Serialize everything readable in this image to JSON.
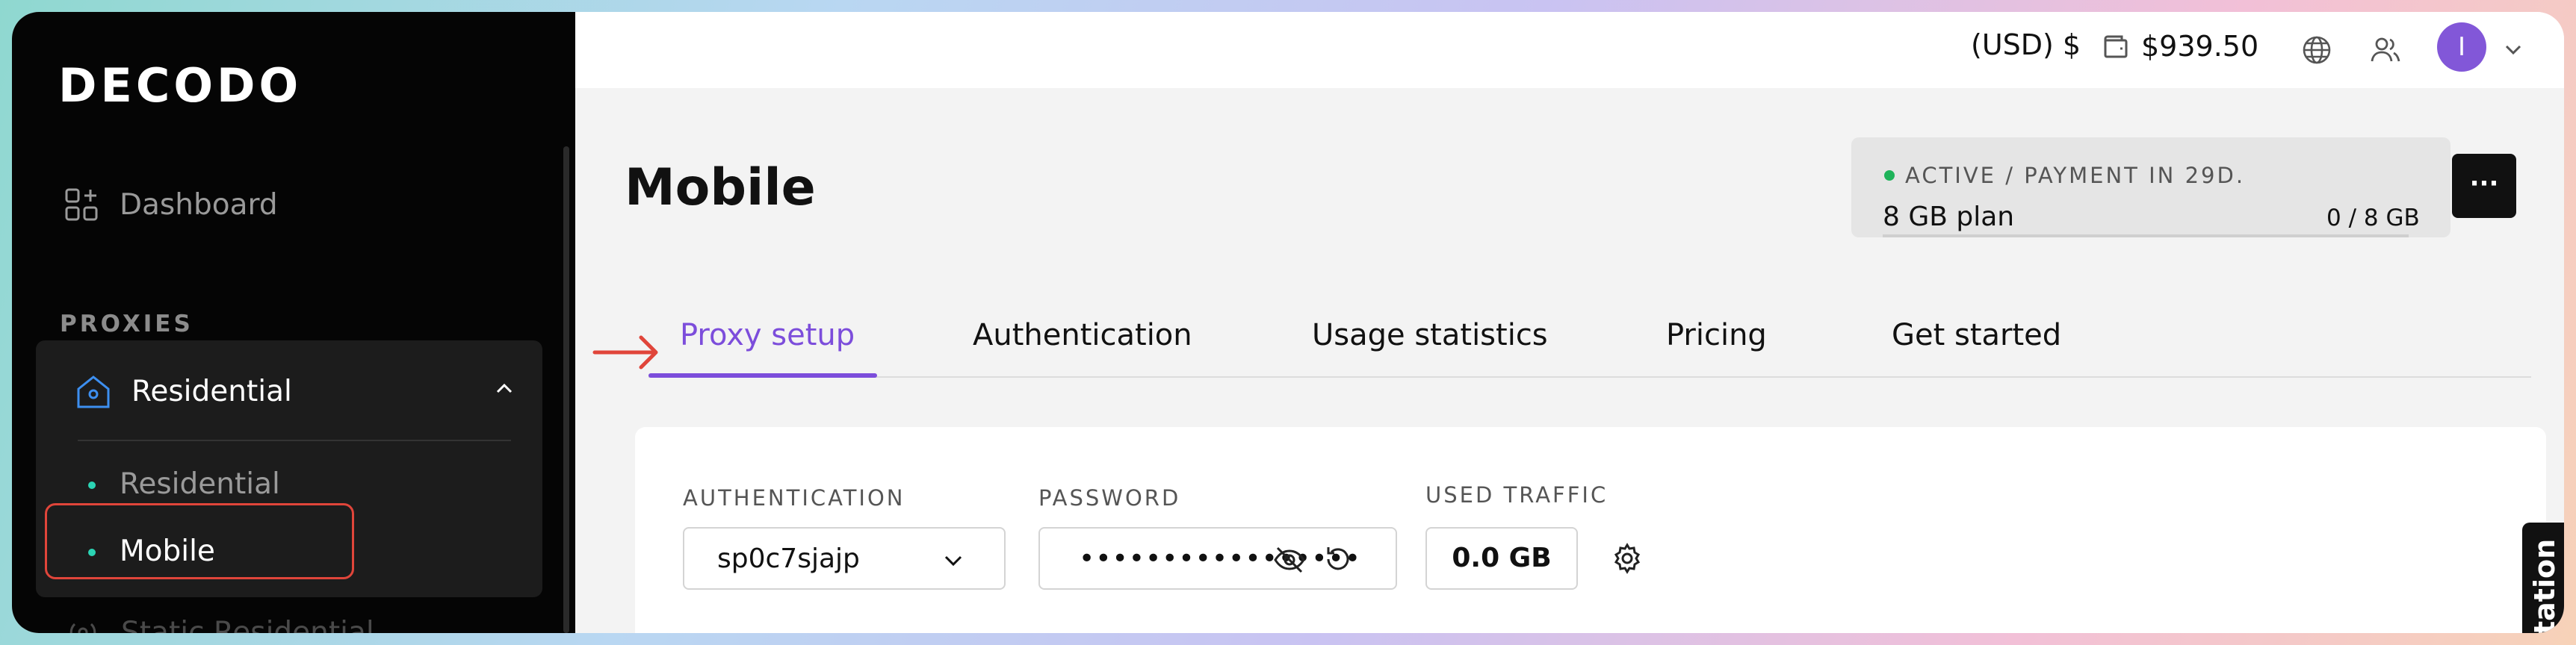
{
  "brand": {
    "logo_text": "DECODO"
  },
  "sidebar": {
    "dashboard_label": "Dashboard",
    "section_label": "PROXIES",
    "group": {
      "label": "Residential",
      "items": [
        {
          "label": "Residential"
        },
        {
          "label": "Mobile"
        }
      ]
    },
    "next_item_label": "Static Residential"
  },
  "topbar": {
    "currency": "(USD) $",
    "balance": "$939.50",
    "avatar_initial": "I"
  },
  "page": {
    "title": "Mobile"
  },
  "plan": {
    "status": "ACTIVE / PAYMENT IN 29D.",
    "name": "8 GB plan",
    "usage": "0 / 8 GB",
    "usage_fraction": 0,
    "more_label": "···"
  },
  "tabs": [
    {
      "label": "Proxy setup",
      "active": true
    },
    {
      "label": "Authentication"
    },
    {
      "label": "Usage statistics"
    },
    {
      "label": "Pricing"
    },
    {
      "label": "Get started"
    }
  ],
  "setup": {
    "auth_label": "AUTHENTICATION",
    "auth_value": "sp0c7sjajp",
    "password_label": "PASSWORD",
    "password_value": "•••••••••••••••••",
    "traffic_label": "USED TRAFFIC",
    "traffic_value": "0.0 GB"
  },
  "side_tab": {
    "label": "Documentation",
    "visible_label": "tation"
  },
  "colors": {
    "accent": "#7c4ddb",
    "status_active": "#1fb35a",
    "highlight": "#e0453a",
    "sidebar_bg": "#050505",
    "bullet": "#2bd4b4"
  },
  "icons": [
    "dashboard-icon",
    "home-icon",
    "chevron-up-icon",
    "wallet-icon",
    "globe-icon",
    "users-icon",
    "chevron-down-icon",
    "eye-off-icon",
    "refresh-icon",
    "gear-icon",
    "arrow-right-icon",
    "static-residential-icon"
  ]
}
